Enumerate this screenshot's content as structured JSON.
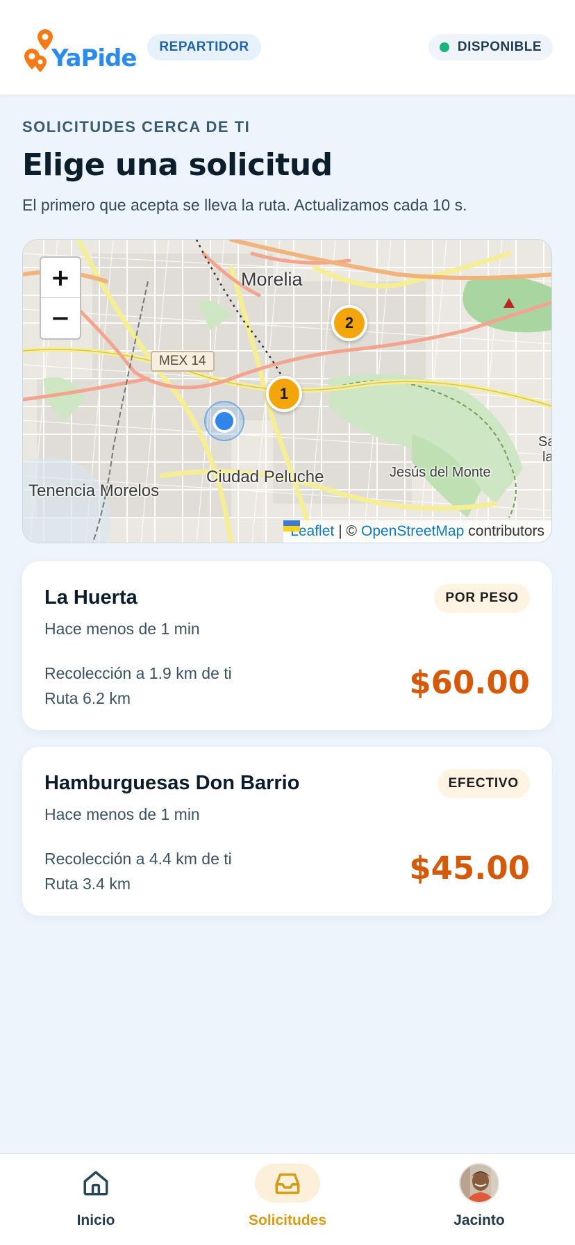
{
  "header": {
    "brand": "YaPide",
    "role_badge": "REPARTIDOR",
    "status_badge": "DISPONIBLE",
    "status_color": "#17b57b",
    "brand_colors": {
      "orange": "#f47a16",
      "blue": "#2a8bea"
    }
  },
  "main": {
    "eyebrow": "SOLICITUDES CERCA DE TI",
    "title": "Elige una solicitud",
    "subtitle": "El primero que acepta se lleva la ruta. Actualizamos cada 10 s."
  },
  "map": {
    "zoom_in": "+",
    "zoom_out": "−",
    "labels": {
      "city": "Morelia",
      "road": "MEX 14",
      "district1": "Ciudad Peluche",
      "district2": "Tenencia Morelos",
      "district3": "Jesús del Monte",
      "edge1": "Sa",
      "edge2": "la"
    },
    "markers": [
      {
        "label": "1"
      },
      {
        "label": "2"
      }
    ],
    "attribution": {
      "leaflet": "Leaflet",
      "separator": "| ©",
      "osm": "OpenStreetMap",
      "suffix": "contributors"
    }
  },
  "requests": [
    {
      "name": "La Huerta",
      "time": "Hace menos de 1 min",
      "tag": "POR PESO",
      "pickup": "Recolección a 1.9 km de ti",
      "route": "Ruta 6.2 km",
      "price": "$60.00"
    },
    {
      "name": "Hamburguesas Don Barrio",
      "time": "Hace menos de 1 min",
      "tag": "EFECTIVO",
      "pickup": "Recolección a 4.4 km de ti",
      "route": "Ruta 3.4 km",
      "price": "$45.00"
    }
  ],
  "bottom_nav": {
    "items": [
      {
        "label": "Inicio",
        "icon": "home-icon"
      },
      {
        "label": "Solicitudes",
        "icon": "inbox-icon",
        "active": true
      },
      {
        "label": "Jacinto",
        "icon": "avatar"
      }
    ],
    "active_color": "#d79a14"
  }
}
